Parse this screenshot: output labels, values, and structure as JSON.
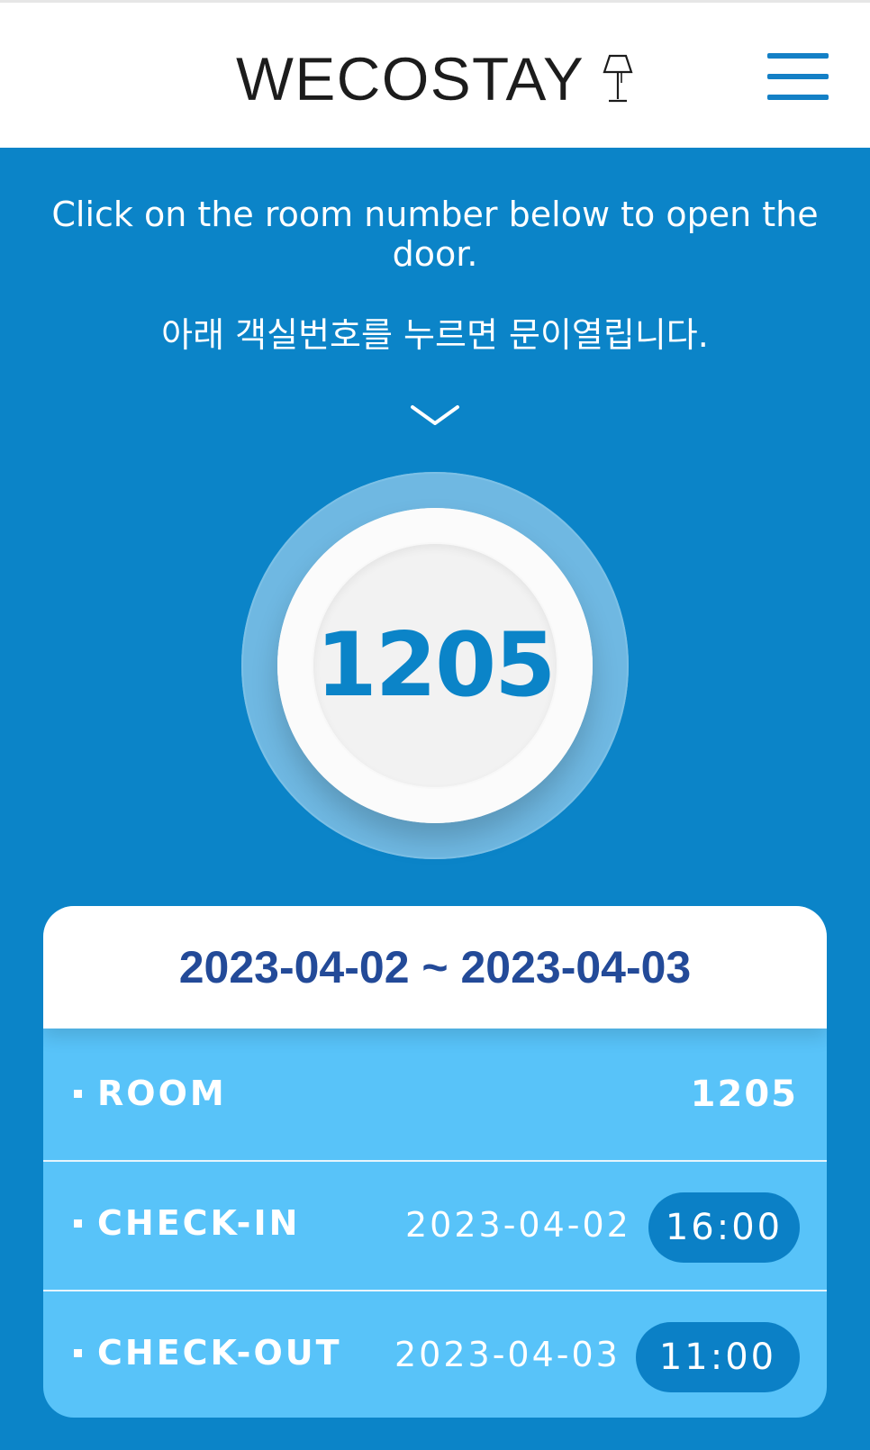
{
  "header": {
    "logo_text": "WECOSTAY"
  },
  "instructions": {
    "english": "Click on the room number below to open the door.",
    "korean": "아래 객실번호를 누르면 문이열립니다."
  },
  "room_button": {
    "number": "1205"
  },
  "reservation": {
    "date_range": "2023-04-02 ~ 2023-04-03",
    "room": {
      "label": "ROOM",
      "value": "1205"
    },
    "check_in": {
      "label": "CHECK-IN",
      "date": "2023-04-02",
      "time": "16:00"
    },
    "check_out": {
      "label": "CHECK-OUT",
      "date": "2023-04-03",
      "time": "11:00"
    }
  },
  "colors": {
    "brand_blue": "#0b84c8",
    "card_light_blue": "#58c3f9",
    "date_navy": "#234a98"
  },
  "icons": {
    "logo": "lamp-icon",
    "menu": "hamburger-menu-icon",
    "hint": "chevron-down-icon"
  }
}
